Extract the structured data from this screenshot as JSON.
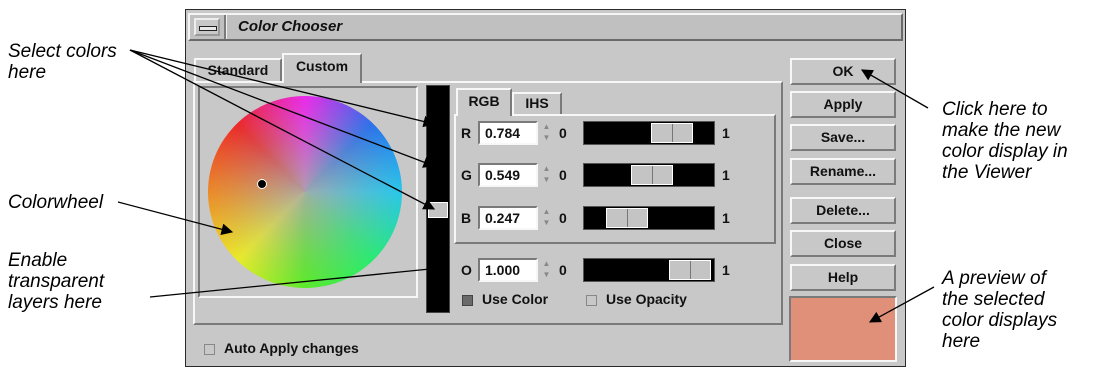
{
  "window": {
    "title": "Color Chooser"
  },
  "tabs": {
    "standard": "Standard",
    "custom": "Custom"
  },
  "model_tabs": {
    "rgb": "RGB",
    "ihs": "IHS"
  },
  "channels": [
    {
      "label": "R",
      "value": "0.784",
      "min": "0",
      "max": "1",
      "level": 0.784
    },
    {
      "label": "G",
      "value": "0.549",
      "min": "0",
      "max": "1",
      "level": 0.549
    },
    {
      "label": "B",
      "value": "0.247",
      "min": "0",
      "max": "1",
      "level": 0.247
    }
  ],
  "opacity": {
    "label": "O",
    "value": "1.000",
    "min": "0",
    "max": "1",
    "level": 1.0
  },
  "checkboxes": {
    "use_color": "Use Color",
    "use_color_checked": true,
    "use_opacity": "Use Opacity",
    "use_opacity_checked": false,
    "auto_apply": "Auto Apply changes",
    "auto_apply_checked": false
  },
  "buttons": {
    "ok": "OK",
    "apply": "Apply",
    "save": "Save...",
    "rename": "Rename...",
    "delete": "Delete...",
    "close": "Close",
    "help": "Help"
  },
  "preview": {
    "color": "#e09078"
  },
  "annotations": {
    "select_colors": "Select colors\nhere",
    "colorwheel": "Colorwheel",
    "transparent": "Enable\ntransparent\nlayers here",
    "ok_click": "Click here to\nmake the new\ncolor display in\nthe Viewer",
    "preview_desc": "A preview of\nthe selected\ncolor displays\nhere"
  }
}
